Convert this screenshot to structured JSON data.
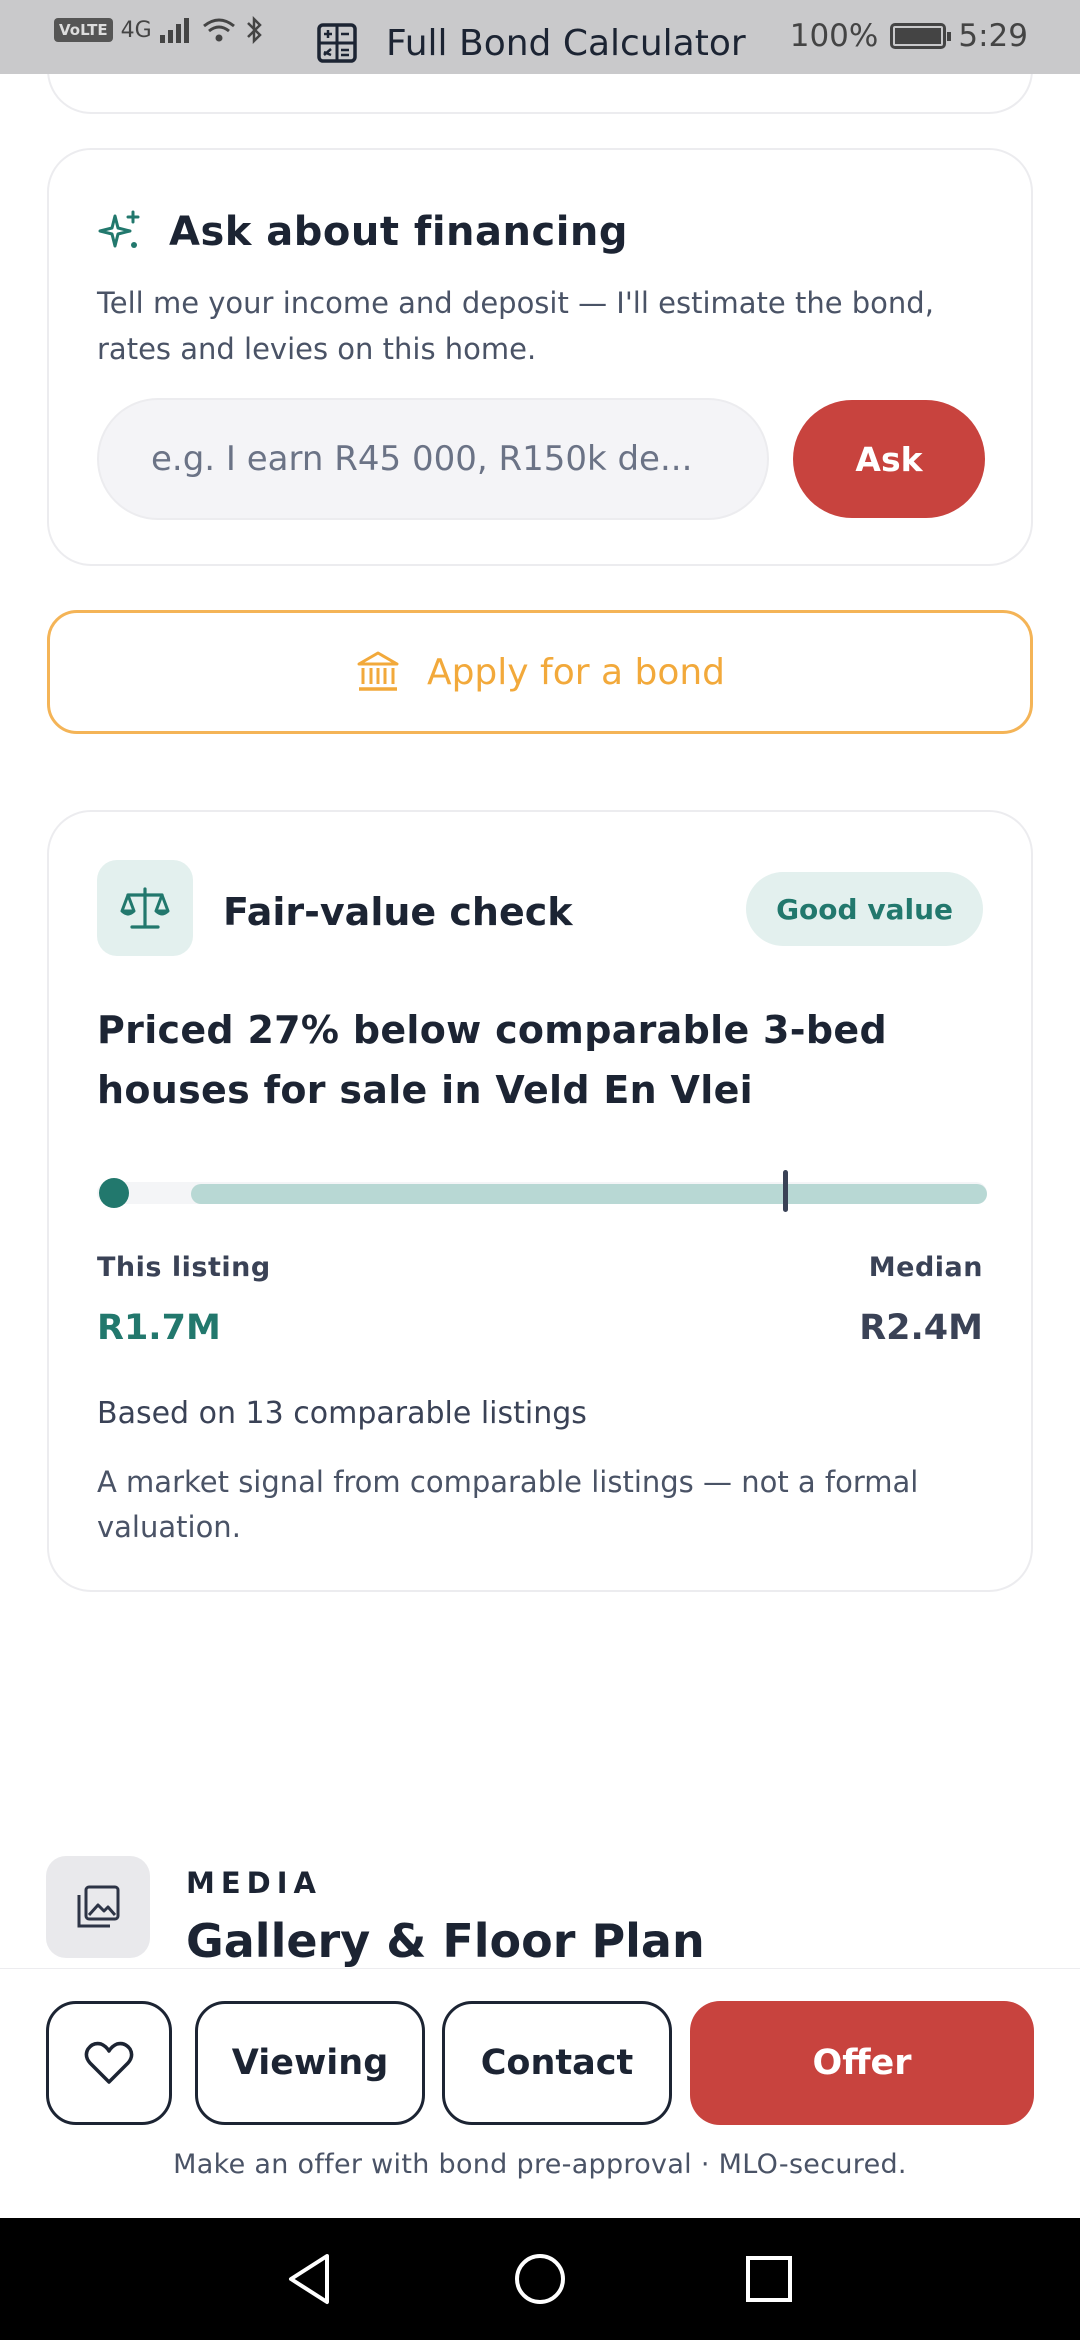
{
  "status_bar": {
    "network": "4G",
    "volte": "VoLTE",
    "battery": "100%",
    "time": "5:29",
    "page_title": "Full Bond Calculator"
  },
  "finance_card": {
    "title": "Ask about financing",
    "description": "Tell me your income and deposit — I'll estimate the bond, rates and levies on this home.",
    "input_placeholder": "e.g. I earn R45 000, R150k de...",
    "ask_label": "Ask"
  },
  "apply_button": {
    "label": "Apply for a bond"
  },
  "fair_value": {
    "title": "Fair-value check",
    "badge": "Good value",
    "headline": "Priced 27% below comparable 3-bed houses for sale in Veld En Vlei",
    "this_listing_label": "This listing",
    "this_listing_value": "R1.7M",
    "median_label": "Median",
    "median_value": "R2.4M",
    "based_on": "Based on 13 comparable listings",
    "note": "A market signal from comparable listings — not a formal valuation."
  },
  "media_section": {
    "kicker": "MEDIA",
    "title": "Gallery & Floor Plan"
  },
  "action_bar": {
    "viewing_label": "Viewing",
    "contact_label": "Contact",
    "offer_label": "Offer",
    "footer_note": "Make an offer with bond pre-approval · MLO-secured."
  },
  "colors": {
    "accent_red": "#c8433e",
    "teal": "#22786d",
    "orange": "#f2a93b"
  }
}
